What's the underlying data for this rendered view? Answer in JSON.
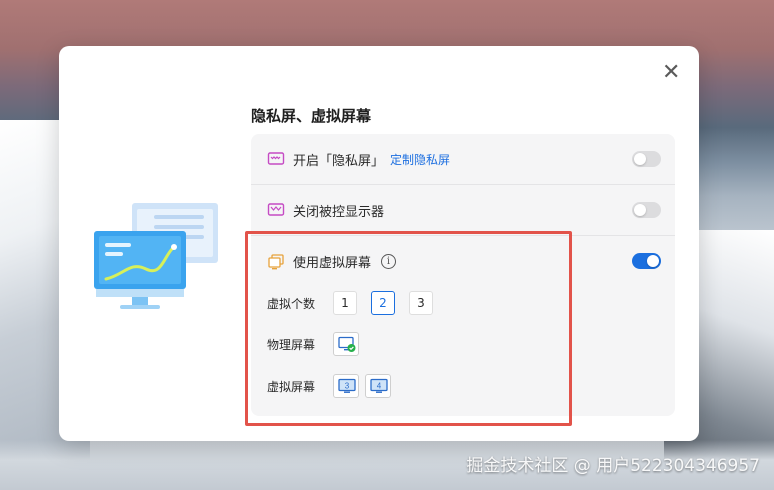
{
  "dialog": {
    "section_title": "隐私屏、虚拟屏幕",
    "rows": [
      {
        "label": "开启「隐私屏」",
        "link": "定制隐私屏",
        "toggle": "off",
        "icon": "privacy-screen-icon"
      },
      {
        "label": "关闭被控显示器",
        "toggle": "off",
        "icon": "monitor-off-icon"
      },
      {
        "label": "使用虚拟屏幕",
        "toggle": "on",
        "icon": "virtual-screen-icon",
        "info_icon": "ⓘ"
      }
    ],
    "virtual_count": {
      "label": "虚拟个数",
      "options": [
        "1",
        "2",
        "3"
      ],
      "selected": "2"
    },
    "physical_screen": {
      "label": "物理屏幕"
    },
    "virtual_screens": {
      "label": "虚拟屏幕",
      "items": [
        "3",
        "4"
      ]
    },
    "close_glyph": "✕"
  },
  "watermark": "掘金技术社区 @ 用户522304346957",
  "colors": {
    "accent": "#1b6fdf",
    "highlight": "#e2534a"
  }
}
